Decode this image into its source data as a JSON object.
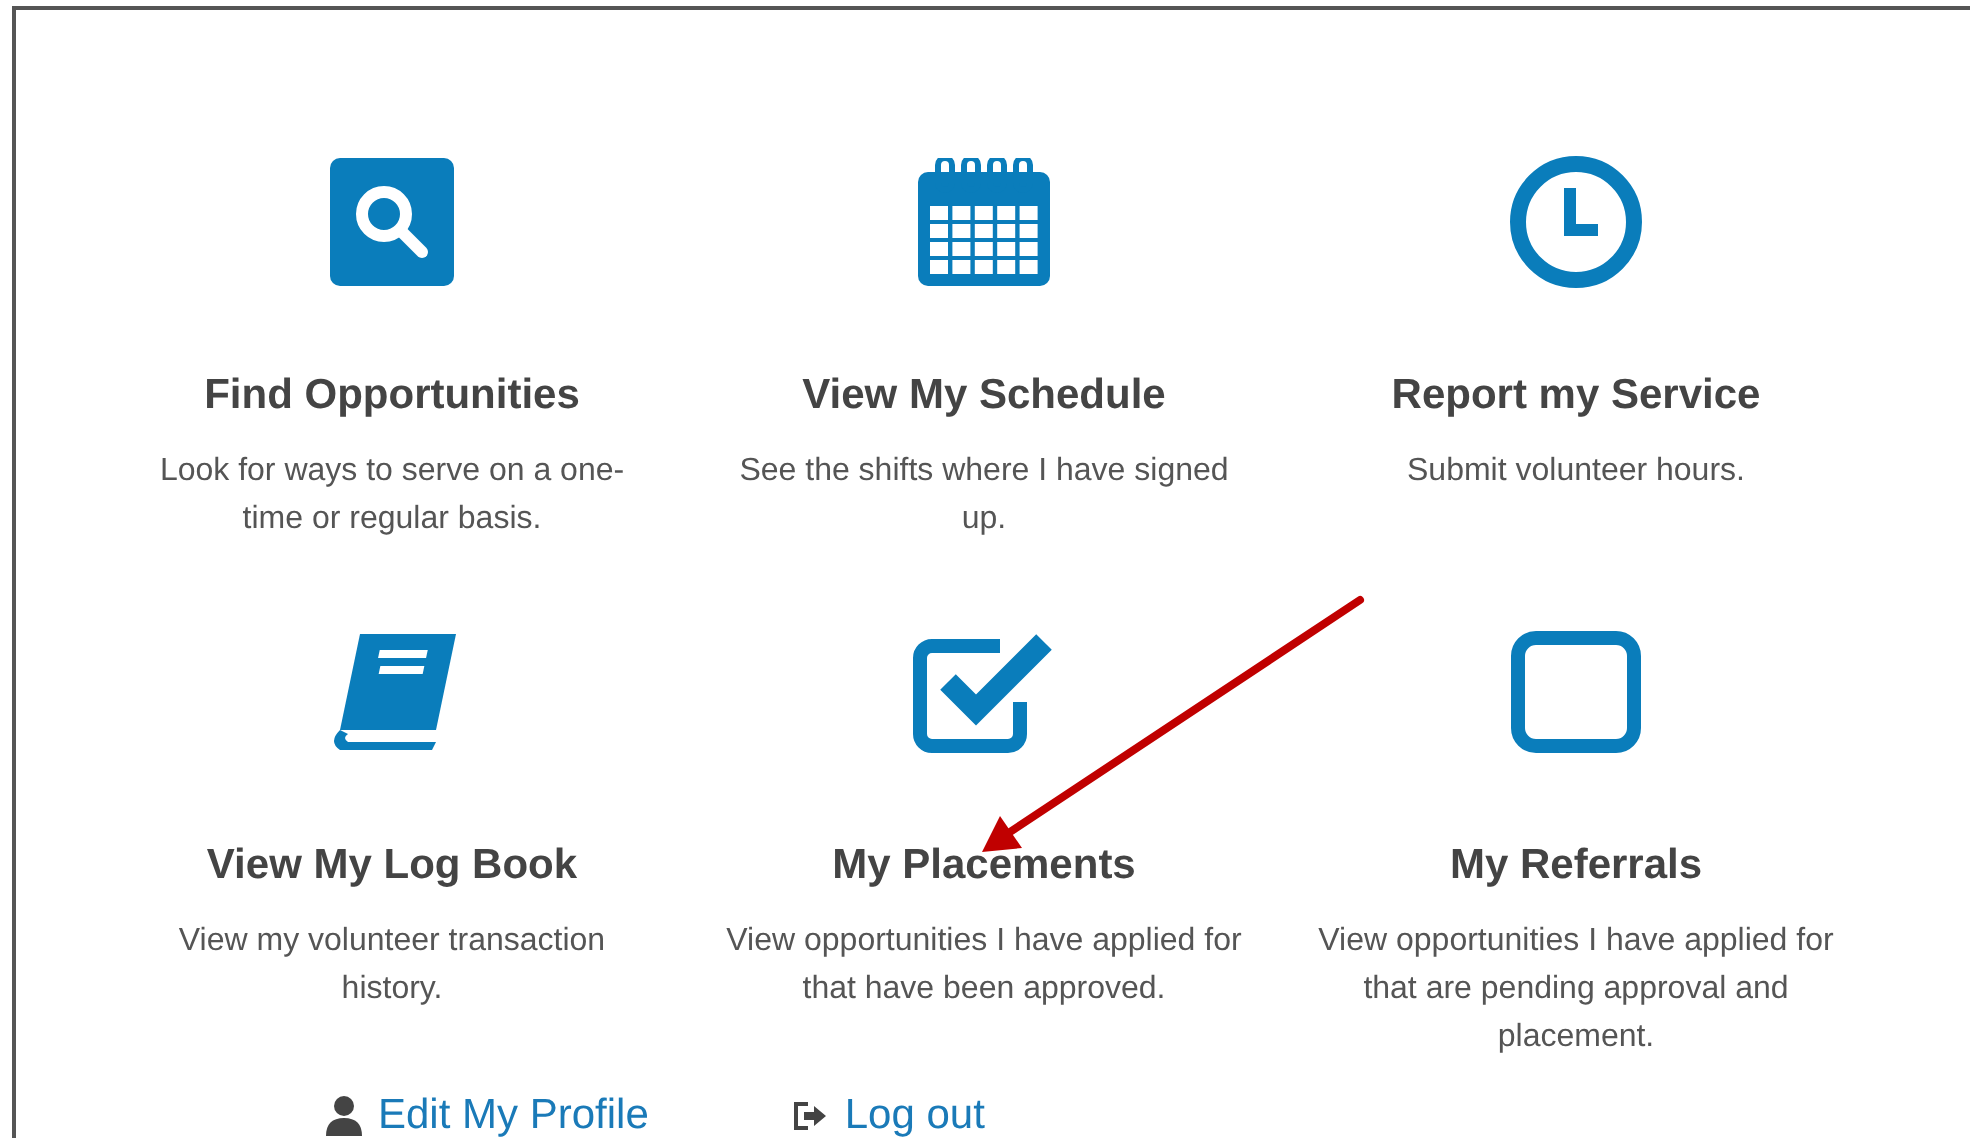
{
  "cards": [
    {
      "kind": "search",
      "title": "Find Opportunities",
      "description": "Look for ways to serve on a one-time or regular basis."
    },
    {
      "kind": "calendar",
      "title": "View My Schedule",
      "description": "See the shifts where I have signed up."
    },
    {
      "kind": "clock",
      "title": "Report my Service",
      "description": "Submit volunteer hours."
    },
    {
      "kind": "book",
      "title": "View My Log Book",
      "description": "View my volunteer transaction history."
    },
    {
      "kind": "checkbox",
      "title": "My Placements",
      "description": "View opportunities I have applied for that have been approved."
    },
    {
      "kind": "square",
      "title": "My Referrals",
      "description": "View opportunities I have applied for that are pending approval and placement."
    }
  ],
  "links": [
    {
      "kind": "profile",
      "label": "Edit My Profile"
    },
    {
      "kind": "logout",
      "label": "Log out"
    }
  ]
}
